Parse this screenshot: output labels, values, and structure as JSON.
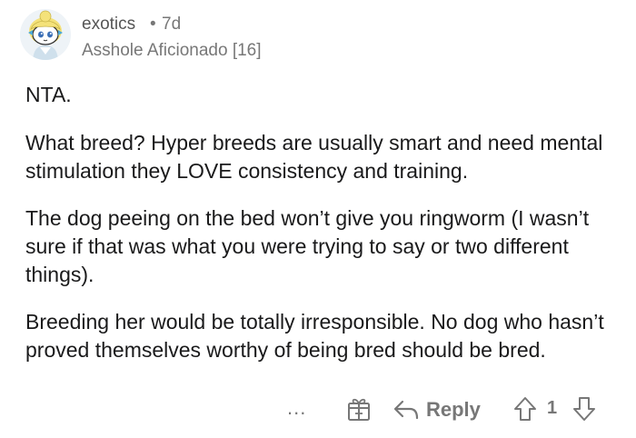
{
  "comment": {
    "author": "exotics",
    "separator": "•",
    "age": "7d",
    "flair": "Asshole Aficionado [16]",
    "paragraphs": [
      "NTA.",
      "What breed?  Hyper breeds are usually smart and need mental stimulation they LOVE consistency and training.",
      "The dog peeing on the bed won’t give you ringworm (I wasn’t sure if that was what you were trying to say or two different things).",
      "Breeding her would be totally irresponsible. No dog who hasn’t proved themselves worthy of being bred should be bred."
    ],
    "actions": {
      "more_label": "...",
      "reply_label": "Reply",
      "score": "1"
    }
  },
  "colors": {
    "text": "#1a1a1b",
    "meta": "#777777",
    "background": "#ffffff"
  },
  "icons": {
    "more": "more-options-icon",
    "award": "gift-award-icon",
    "reply": "reply-arrow-icon",
    "upvote": "upvote-arrow-icon",
    "downvote": "downvote-arrow-icon"
  }
}
